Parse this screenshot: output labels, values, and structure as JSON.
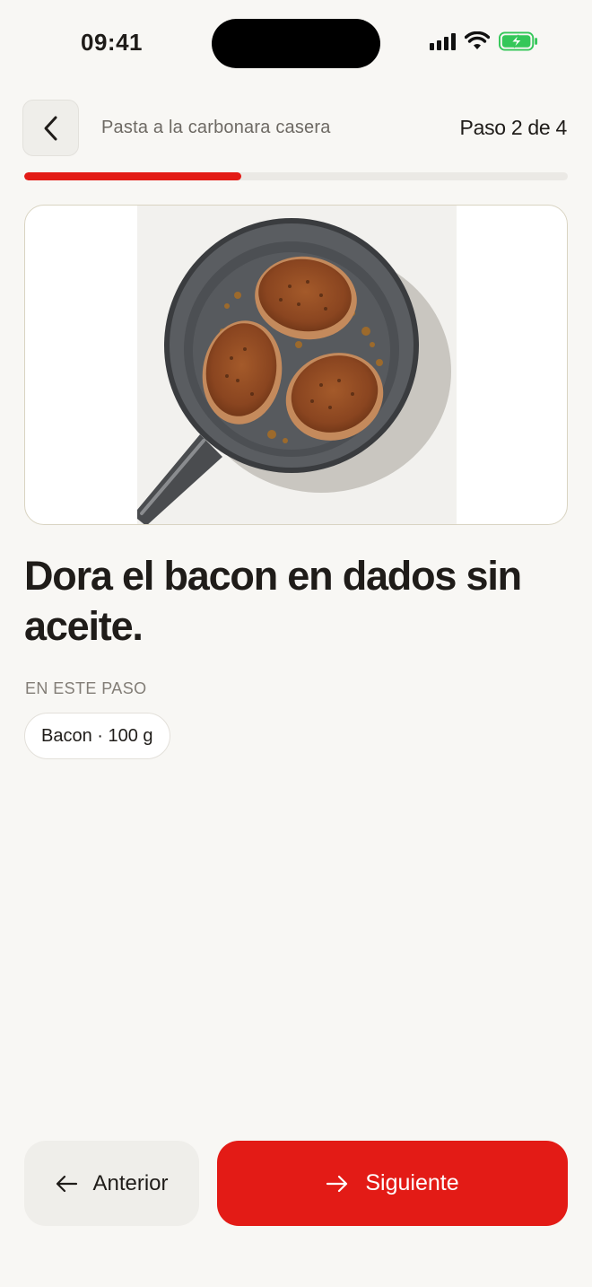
{
  "status_bar": {
    "time": "09:41",
    "icons": [
      "signal-icon",
      "wifi-icon",
      "battery-charging-icon"
    ]
  },
  "header": {
    "back_icon": "chevron-left-icon",
    "recipe_title": "Pasta a la carbonara casera",
    "step_counter": "Paso 2 de 4",
    "progress": 0.4
  },
  "step": {
    "image_subject": "frying-pan-with-bacon",
    "instruction": "Dora el bacon en dados sin aceite.",
    "section_label": "EN ESTE PASO",
    "ingredients": [
      "Bacon · 100 g"
    ]
  },
  "footer": {
    "prev_label": "Anterior",
    "prev_icon": "arrow-left-icon",
    "next_label": "Siguiente",
    "next_icon": "arrow-right-icon"
  },
  "colors": {
    "accent": "#e31b16",
    "background": "#f8f7f4",
    "battery": "#34c759"
  }
}
